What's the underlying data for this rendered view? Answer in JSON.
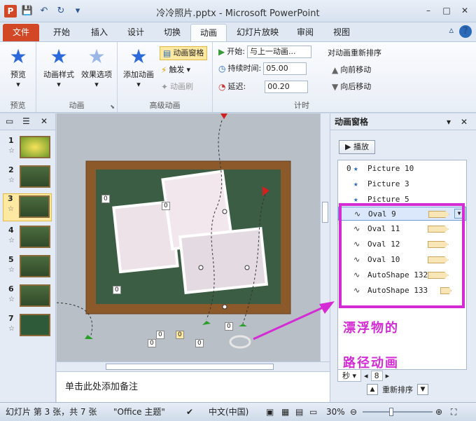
{
  "window": {
    "title": "冷冷照片.pptx - Microsoft PowerPoint",
    "minimize": "–",
    "maximize": "□",
    "close": "✕"
  },
  "qat": {
    "save": "💾",
    "undo": "↶",
    "redo": "↻",
    "more": "▾"
  },
  "app_logo": "P",
  "tabs": [
    "文件",
    "开始",
    "插入",
    "设计",
    "切换",
    "动画",
    "幻灯片放映",
    "审阅",
    "视图"
  ],
  "active_tab": "动画",
  "ribbon": {
    "preview_group": {
      "label": "预览",
      "button": "预览"
    },
    "animation_group": {
      "label": "动画",
      "style_btn": "动画样式",
      "effect_btn": "效果选项"
    },
    "advanced_group": {
      "label": "高级动画",
      "add_btn": "添加动画",
      "pane_btn": "动画窗格",
      "trigger_btn": "触发",
      "painter_btn": "动画刷"
    },
    "timing_group": {
      "label": "计时",
      "start_label": "开始:",
      "start_value": "与上一动画...",
      "duration_label": "持续时间:",
      "duration_value": "05.00",
      "delay_label": "延迟:",
      "delay_value": "00.20",
      "reorder_label": "对动画重新排序",
      "forward": "向前移动",
      "backward": "向后移动"
    }
  },
  "slides": [
    {
      "num": "1",
      "star": "☆"
    },
    {
      "num": "2",
      "star": "☆"
    },
    {
      "num": "3",
      "star": "☆"
    },
    {
      "num": "4",
      "star": "☆"
    },
    {
      "num": "5",
      "star": "☆"
    },
    {
      "num": "6",
      "star": "☆"
    },
    {
      "num": "7",
      "star": "☆"
    }
  ],
  "slide_tags": [
    "0",
    "0",
    "0",
    "0",
    "0",
    "0",
    "0",
    "0"
  ],
  "notes_placeholder": "单击此处添加备注",
  "anim_pane": {
    "title": "动画窗格",
    "play": "▶ 播放",
    "items": [
      {
        "num": "0",
        "icon": "★",
        "name": "Picture 10"
      },
      {
        "num": "",
        "icon": "★",
        "name": "Picture 3"
      },
      {
        "num": "",
        "icon": "★",
        "name": "Picture 5"
      },
      {
        "num": "",
        "icon": "∿",
        "name": "Oval 9"
      },
      {
        "num": "",
        "icon": "∿",
        "name": "Oval 11"
      },
      {
        "num": "",
        "icon": "∿",
        "name": "Oval 12"
      },
      {
        "num": "",
        "icon": "∿",
        "name": "Oval 10"
      },
      {
        "num": "",
        "icon": "∿",
        "name": "AutoShape 132"
      },
      {
        "num": "",
        "icon": "∿",
        "name": "AutoShape 133"
      }
    ],
    "seconds_label": "秒",
    "seconds_value": "8",
    "reorder": "重新排序"
  },
  "annotation": {
    "line1": "漂浮物的",
    "line2": "路径动画"
  },
  "statusbar": {
    "slide_info": "幻灯片 第 3 张，共 7 张",
    "theme": "\"Office 主题\"",
    "language": "中文(中国)",
    "zoom": "30%"
  }
}
